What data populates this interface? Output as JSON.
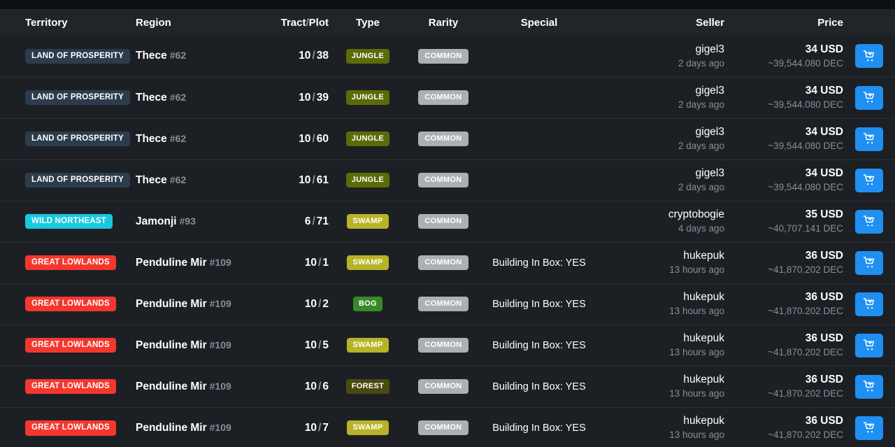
{
  "table": {
    "columns": [
      {
        "key": "territory",
        "label": "Territory"
      },
      {
        "key": "region",
        "label": "Region"
      },
      {
        "key": "tract",
        "label_a": "Tract",
        "label_sep": "/",
        "label_b": "Plot"
      },
      {
        "key": "type",
        "label": "Type"
      },
      {
        "key": "rarity",
        "label": "Rarity"
      },
      {
        "key": "special",
        "label": "Special"
      },
      {
        "key": "seller",
        "label": "Seller"
      },
      {
        "key": "price",
        "label": "Price"
      },
      {
        "key": "action",
        "label": ""
      }
    ],
    "rows": [
      {
        "territory": "LAND OF PROSPERITY",
        "territory_color": "#2c3c4c",
        "region_name": "Thece",
        "region_id": "#62",
        "tract": "10",
        "plot": "38",
        "type": "JUNGLE",
        "type_color": "#5c6b07",
        "rarity": "COMMON",
        "rarity_color": "#adb0b3",
        "special": "",
        "seller_name": "gigel3",
        "seller_time": "2 days ago",
        "price_usd": "34 USD",
        "price_dec": "~39,544.080 DEC",
        "action_label": "add-to-cart"
      },
      {
        "territory": "LAND OF PROSPERITY",
        "territory_color": "#2c3c4c",
        "region_name": "Thece",
        "region_id": "#62",
        "tract": "10",
        "plot": "39",
        "type": "JUNGLE",
        "type_color": "#5c6b07",
        "rarity": "COMMON",
        "rarity_color": "#adb0b3",
        "special": "",
        "seller_name": "gigel3",
        "seller_time": "2 days ago",
        "price_usd": "34 USD",
        "price_dec": "~39,544.080 DEC",
        "action_label": "add-to-cart"
      },
      {
        "territory": "LAND OF PROSPERITY",
        "territory_color": "#2c3c4c",
        "region_name": "Thece",
        "region_id": "#62",
        "tract": "10",
        "plot": "60",
        "type": "JUNGLE",
        "type_color": "#5c6b07",
        "rarity": "COMMON",
        "rarity_color": "#adb0b3",
        "special": "",
        "seller_name": "gigel3",
        "seller_time": "2 days ago",
        "price_usd": "34 USD",
        "price_dec": "~39,544.080 DEC",
        "action_label": "add-to-cart"
      },
      {
        "territory": "LAND OF PROSPERITY",
        "territory_color": "#2c3c4c",
        "region_name": "Thece",
        "region_id": "#62",
        "tract": "10",
        "plot": "61",
        "type": "JUNGLE",
        "type_color": "#5c6b07",
        "rarity": "COMMON",
        "rarity_color": "#adb0b3",
        "special": "",
        "seller_name": "gigel3",
        "seller_time": "2 days ago",
        "price_usd": "34 USD",
        "price_dec": "~39,544.080 DEC",
        "action_label": "add-to-cart"
      },
      {
        "territory": "WILD NORTHEAST",
        "territory_color": "#18c8e0",
        "region_name": "Jamonji",
        "region_id": "#93",
        "tract": "6",
        "plot": "71",
        "type": "SWAMP",
        "type_color": "#b8b326",
        "rarity": "COMMON",
        "rarity_color": "#adb0b3",
        "special": "",
        "seller_name": "cryptobogie",
        "seller_time": "4 days ago",
        "price_usd": "35 USD",
        "price_dec": "~40,707.141 DEC",
        "action_label": "add-to-cart"
      },
      {
        "territory": "GREAT LOWLANDS",
        "territory_color": "#f4372e",
        "region_name": "Penduline Mir",
        "region_id": "#109",
        "tract": "10",
        "plot": "1",
        "type": "SWAMP",
        "type_color": "#b8b326",
        "rarity": "COMMON",
        "rarity_color": "#adb0b3",
        "special": "Building In Box: YES",
        "seller_name": "hukepuk",
        "seller_time": "13 hours ago",
        "price_usd": "36 USD",
        "price_dec": "~41,870.202 DEC",
        "action_label": "add-to-cart"
      },
      {
        "territory": "GREAT LOWLANDS",
        "territory_color": "#f4372e",
        "region_name": "Penduline Mir",
        "region_id": "#109",
        "tract": "10",
        "plot": "2",
        "type": "BOG",
        "type_color": "#388a27",
        "rarity": "COMMON",
        "rarity_color": "#adb0b3",
        "special": "Building In Box: YES",
        "seller_name": "hukepuk",
        "seller_time": "13 hours ago",
        "price_usd": "36 USD",
        "price_dec": "~41,870.202 DEC",
        "action_label": "add-to-cart"
      },
      {
        "territory": "GREAT LOWLANDS",
        "territory_color": "#f4372e",
        "region_name": "Penduline Mir",
        "region_id": "#109",
        "tract": "10",
        "plot": "5",
        "type": "SWAMP",
        "type_color": "#b8b326",
        "rarity": "COMMON",
        "rarity_color": "#adb0b3",
        "special": "Building In Box: YES",
        "seller_name": "hukepuk",
        "seller_time": "13 hours ago",
        "price_usd": "36 USD",
        "price_dec": "~41,870.202 DEC",
        "action_label": "add-to-cart"
      },
      {
        "territory": "GREAT LOWLANDS",
        "territory_color": "#f4372e",
        "region_name": "Penduline Mir",
        "region_id": "#109",
        "tract": "10",
        "plot": "6",
        "type": "FOREST",
        "type_color": "#4a4a10",
        "rarity": "COMMON",
        "rarity_color": "#adb0b3",
        "special": "Building In Box: YES",
        "seller_name": "hukepuk",
        "seller_time": "13 hours ago",
        "price_usd": "36 USD",
        "price_dec": "~41,870.202 DEC",
        "action_label": "add-to-cart"
      },
      {
        "territory": "GREAT LOWLANDS",
        "territory_color": "#f4372e",
        "region_name": "Penduline Mir",
        "region_id": "#109",
        "tract": "10",
        "plot": "7",
        "type": "SWAMP",
        "type_color": "#b8b326",
        "rarity": "COMMON",
        "rarity_color": "#adb0b3",
        "special": "Building In Box: YES",
        "seller_name": "hukepuk",
        "seller_time": "13 hours ago",
        "price_usd": "36 USD",
        "price_dec": "~41,870.202 DEC",
        "action_label": "add-to-cart"
      }
    ]
  },
  "theme": {
    "page_background": "#0d1013",
    "header_background": "#212529",
    "row_background": "#1c2025",
    "row_divider": "#2b3036",
    "text_primary": "#ffffff",
    "text_muted": "#868e96",
    "accent_button": "#1f90f2"
  }
}
